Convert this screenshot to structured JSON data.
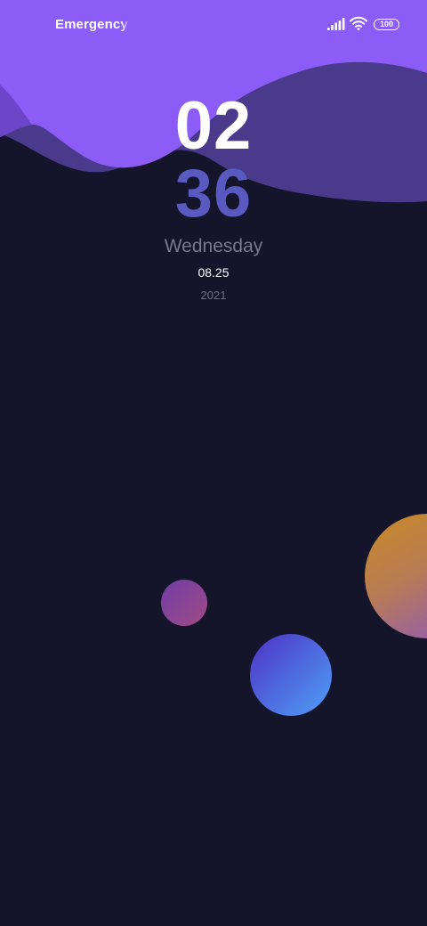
{
  "status_bar": {
    "carrier_text": "Emergency c",
    "battery_level": "100",
    "signal_icon": "signal-bars-icon",
    "wifi_icon": "wifi-icon"
  },
  "lockscreen": {
    "hours": "02",
    "minutes": "36",
    "weekday": "Wednesday",
    "date": "08.25",
    "year": "2021"
  },
  "colors": {
    "background": "#14152b",
    "wave_front": "#8b5cf6",
    "wave_back": "#4a3a8c",
    "minutes_accent": "#5a59c2"
  }
}
